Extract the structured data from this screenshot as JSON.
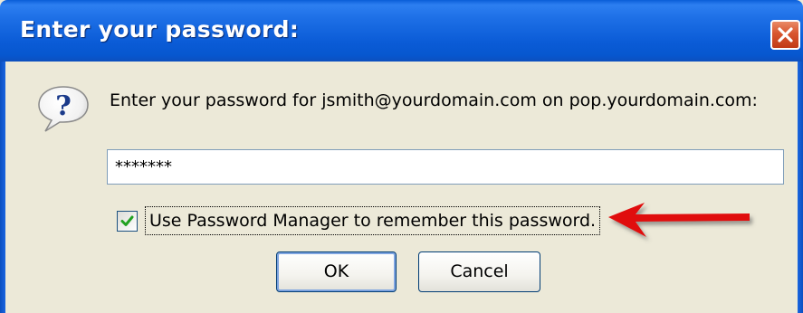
{
  "window": {
    "title": "Enter your password:"
  },
  "titlebar": {
    "close_icon": "close-x-icon"
  },
  "dialog": {
    "icon": "question-bubble-icon",
    "prompt": "Enter your password for  jsmith@yourdomain.com on pop.yourdomain.com:",
    "password_value": "*******",
    "remember_label": "Use Password Manager to remember this password.",
    "remember_checked": true,
    "annotation_icon": "red-arrow-icon"
  },
  "buttons": {
    "ok_label": "OK",
    "cancel_label": "Cancel"
  }
}
